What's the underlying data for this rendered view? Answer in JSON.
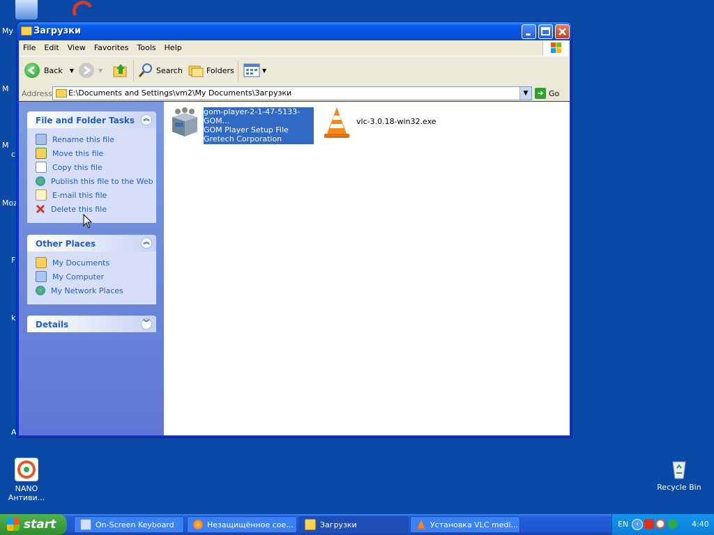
{
  "desktop": {
    "icons": [
      {
        "label": "NANO Антиви..."
      },
      {
        "label": "Recycle Bin"
      }
    ],
    "edge_labels": [
      "My",
      "M",
      "M",
      "c",
      "Moz",
      "F",
      "k",
      "A"
    ]
  },
  "window": {
    "title": "Загрузки",
    "menu": [
      "File",
      "Edit",
      "View",
      "Favorites",
      "Tools",
      "Help"
    ],
    "toolbar": {
      "back": "Back",
      "search": "Search",
      "folders": "Folders"
    },
    "address": {
      "label": "Address",
      "value": "E:\\Documents and Settings\\vm2\\My Documents\\Загрузки",
      "go": "Go"
    },
    "tasks_panel": {
      "title": "File and Folder Tasks",
      "items": [
        {
          "label": "Rename this file",
          "icon": "rename-icon"
        },
        {
          "label": "Move this file",
          "icon": "move-icon"
        },
        {
          "label": "Copy this file",
          "icon": "copy-icon"
        },
        {
          "label": "Publish this file to the Web",
          "icon": "globe-icon"
        },
        {
          "label": "E-mail this file",
          "icon": "email-icon"
        },
        {
          "label": "Delete this file",
          "icon": "delete-icon"
        }
      ]
    },
    "places_panel": {
      "title": "Other Places",
      "items": [
        {
          "label": "My Documents"
        },
        {
          "label": "My Computer"
        },
        {
          "label": "My Network Places"
        }
      ]
    },
    "details_panel": {
      "title": "Details"
    },
    "files": [
      {
        "name": "gom-player-2-1-47-5133-GOM...",
        "type": "GOM Player Setup File",
        "company": "Gretech Corporation",
        "selected": true
      },
      {
        "name": "vlc-3.0.18-win32.exe"
      }
    ]
  },
  "taskbar": {
    "start": "start",
    "tasks": [
      {
        "label": "On-Screen Keyboard"
      },
      {
        "label": "Незащищённое сое..."
      },
      {
        "label": "Загрузки"
      },
      {
        "label": "Установка VLC medi..."
      }
    ],
    "lang": "EN",
    "clock": "4:40"
  },
  "colors": {
    "accent": "#215dc6",
    "selection": "#316ac5",
    "desktop": "#0a4aa6"
  }
}
